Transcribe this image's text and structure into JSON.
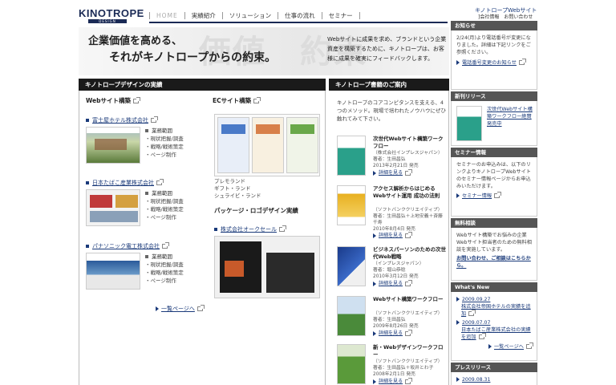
{
  "header": {
    "logo": "KINOTROPE",
    "logo_sub": "DESIGN",
    "nav": [
      "HOME",
      "実績紹介",
      "ソリューション",
      "仕事の流れ",
      "セミナー"
    ],
    "site_title": "キノトロープWebサイト",
    "util_links": [
      "]会社情報",
      "お問い合わせ"
    ]
  },
  "hero": {
    "bg_text": "価値　約束",
    "line1": "企業価値を高める、",
    "line2": "それがキノトロープからの約束。",
    "right_text": "Webサイトに成果を求め、ブランドという企業資産を構築するために、キノトロープは、お客様に成果を確実にフィードバックします。"
  },
  "works": {
    "header": "キノトロープデザインの実績",
    "web_heading": "Webサイト構築",
    "ec_heading": "ECサイト構築",
    "pkg_heading": "パッケージ・ロゴデザイン実績",
    "service_heading": "業務範囲",
    "clients": [
      {
        "name": "富士屋ホテル株式会社",
        "services": [
          "・現状把握/調査",
          "・戦略/戦術策定",
          "・ページ制作"
        ]
      },
      {
        "name": "日本たばこ産業株式会社",
        "services": [
          "・現状把握/調査",
          "・戦略/戦術策定",
          "・ページ制作"
        ]
      },
      {
        "name": "パナソニック電工株式会社",
        "services": [
          "・現状把握/調査",
          "・戦略/戦術策定",
          "・ページ制作"
        ]
      }
    ],
    "ec_caption": [
      "プレモランド",
      "ギフト・ランド",
      "シュライビ・ランド"
    ],
    "pkg_client": "株式会社オークセール",
    "more": "一覧ページへ"
  },
  "books": {
    "header": "キノトロープ書籍のご案内",
    "intro": "キノトロープのコアコンピタンスを支える、4つのメソッド。現場で培われたノウハウにぜひ触れてみて下さい。",
    "items": [
      {
        "title": "次世代Webサイト構築ワークフロー",
        "publisher": "（株式会社インプレスジャパン）",
        "author": "著者：生田昌弘",
        "date": "2013年2月21日 発売",
        "link": "詳細を見る",
        "cover": "#2aa08a"
      },
      {
        "title": "アクセス解析からはじめる Webサイト運用 成功の法則",
        "publisher": "（ソフトバンククリエイティブ）",
        "author": "著者：生田昌弘＋上地安義＋斉藤千寿",
        "date": "2010年8月4日 発売",
        "link": "詳細を見る",
        "cover": "#e8b020"
      },
      {
        "title": "ビジネスパーソンのための次世代Web戦略",
        "publisher": "（インプレスジャパン）",
        "author": "著者：堀山恭稔",
        "date": "2010年3月12日 発売",
        "link": "詳細を見る",
        "cover": "#2255aa"
      },
      {
        "title": "Webサイト構築ワークフロー",
        "publisher": "（ソフトバンククリエイティブ）",
        "author": "著者：生田昌弘",
        "date": "2009年8月26日 発売",
        "link": "詳細を見る",
        "cover": "#4a8a3a"
      },
      {
        "title": "新・Webデザインワークフロー",
        "publisher": "（ソフトバンククリエイティブ）",
        "author": "著者：生田昌弘＋坂井とわ子",
        "date": "2008年2月1日 発売",
        "link": "詳細を見る",
        "cover": "#5a9a3a"
      }
    ]
  },
  "sidebar": {
    "notice_h": "お知らせ",
    "notice_text": "2/24(月)より電話番号が変更になりました。詳細は下記リンクをご参照ください。",
    "notice_link": "電話番号変更のお知らせ",
    "new_h": "新刊リリース",
    "new_text": "次世代Webサイト構築ワークフロー絶賛発売中",
    "seminar_h": "セミナー情報",
    "seminar_text": "セミナーのお申込みは、以下のリンクよりキノトロープWebサイトのセミナー情報ページからお申込みいただけます。",
    "seminar_link": "セミナー情報",
    "consult_h": "無料相談",
    "consult_text": "Webサイト構築でお悩みの企業Webサイト担当者のための無料相談を実施しています。",
    "consult_link": "お問い合わせ、ご相談はこちらから。",
    "whatsnew_h": "What's New",
    "news": [
      {
        "date": "2009.09.27",
        "text": "株式会社帝国ホテルの実績を追加"
      },
      {
        "date": "2009.07.07",
        "text": "日本たばこ産業株式会社の実績を追加"
      }
    ],
    "news_more": "一覧ページへ",
    "press_h": "プレスリリース",
    "press_date": "2009.08.31"
  }
}
